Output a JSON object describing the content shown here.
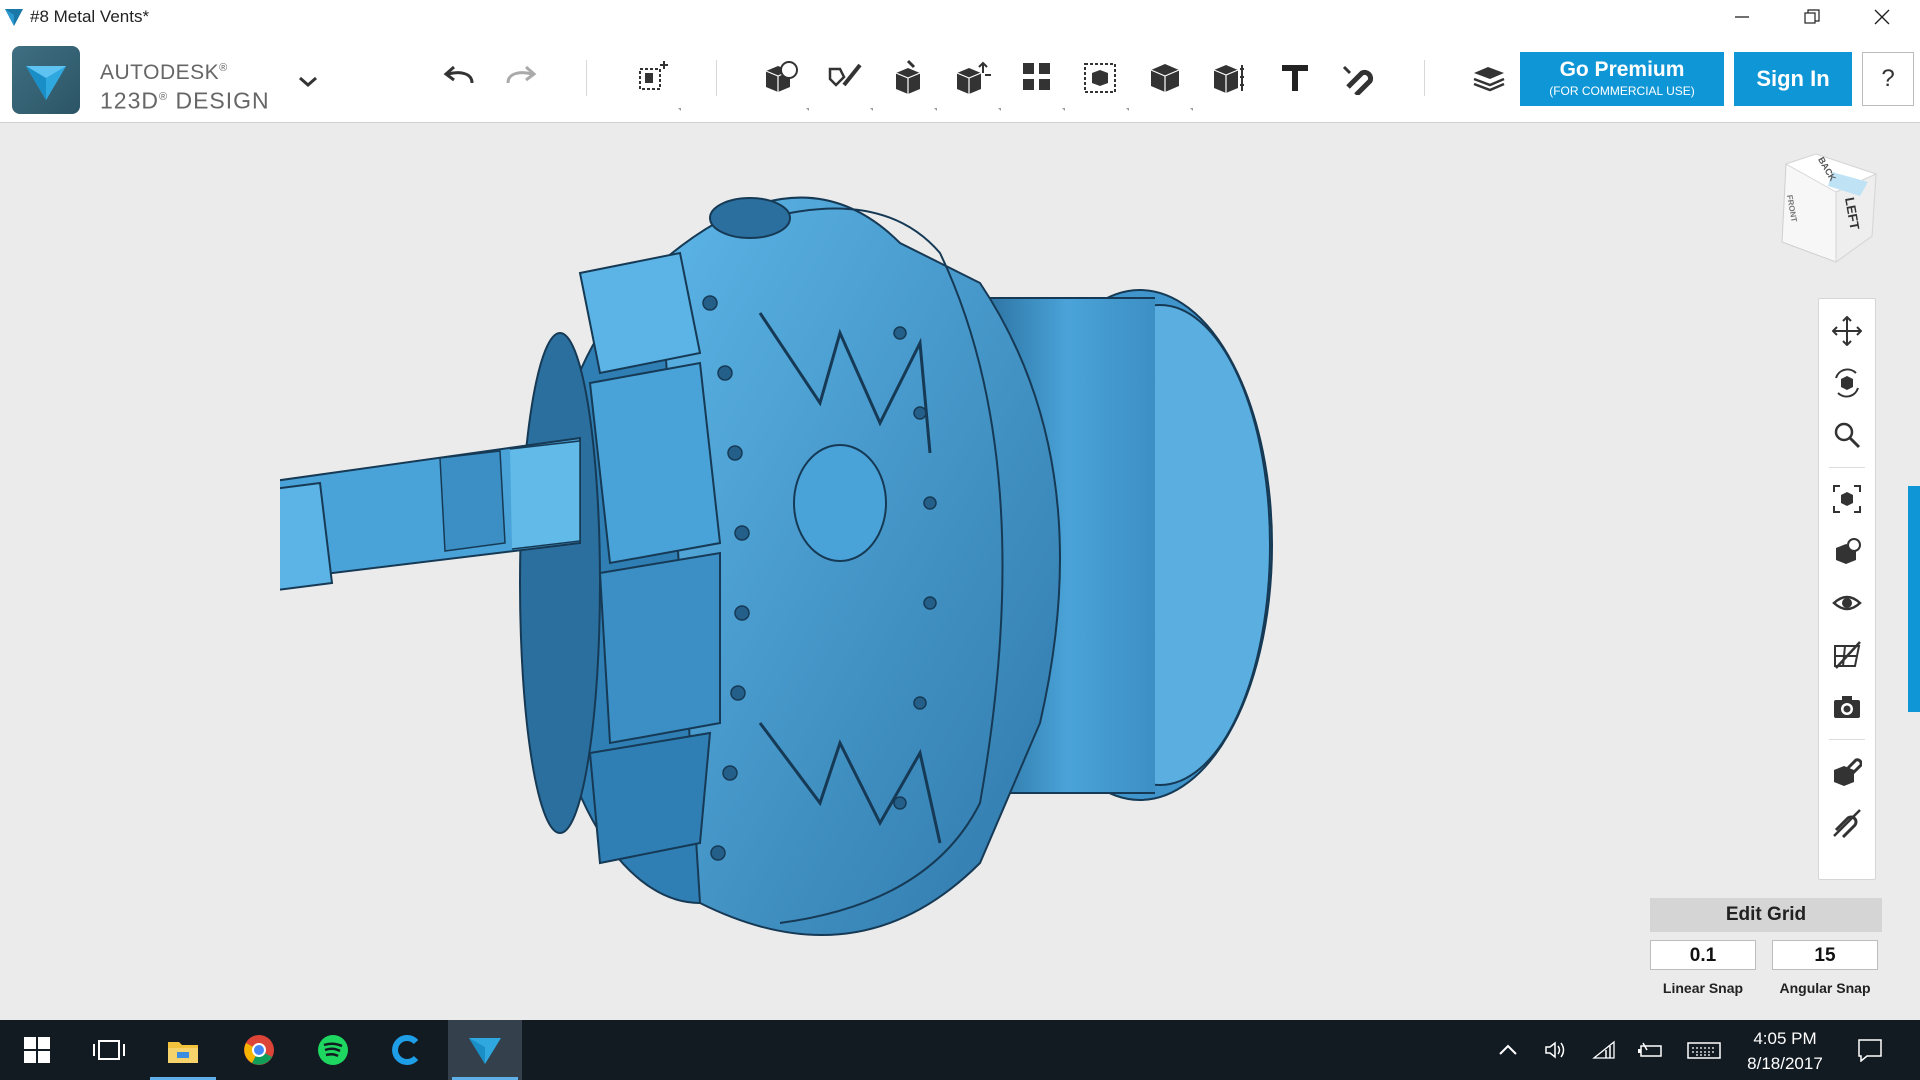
{
  "window": {
    "title": "#8 Metal Vents*"
  },
  "brand": {
    "line1": "AUTODESK",
    "line2": "123D",
    "line2b": "DESIGN",
    "reg": "®"
  },
  "toolbar": {
    "undo": "undo-icon",
    "redo": "redo-icon",
    "tools": [
      "primitives-icon",
      "sketch-icon",
      "construct-icon",
      "modify-icon",
      "pattern-icon",
      "grouping-icon",
      "combine-icon",
      "measure-icon",
      "text-icon",
      "snap-icon"
    ],
    "materials": "materials-icon"
  },
  "premium": {
    "label": "Go Premium",
    "sub": "(FOR COMMERCIAL USE)"
  },
  "signin": {
    "label": "Sign In"
  },
  "help": {
    "label": "?"
  },
  "viewcube": {
    "face_left": "LEFT",
    "face_back": "BACK",
    "face_front": "FRONT"
  },
  "grid": {
    "title": "Edit Grid",
    "linear_value": "0.1",
    "angular_value": "15",
    "linear_label": "Linear Snap",
    "angular_label": "Angular Snap"
  },
  "taskbar": {
    "time": "4:05 PM",
    "date": "8/18/2017"
  },
  "colors": {
    "accent": "#0f96d6",
    "model": "#4aa3d8",
    "taskbar": "#131b22"
  }
}
